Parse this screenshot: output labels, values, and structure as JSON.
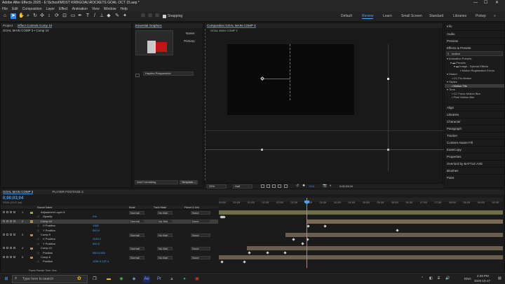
{
  "titlebar": {
    "title": "Adobe After Effects 2025 - E:\\School\\MOST KR8\\GOAL\\ROCKETS GOAL OCT 15.aep *",
    "min": "—",
    "max": "☐",
    "close": "✕"
  },
  "menu": [
    "File",
    "Edit",
    "Composition",
    "Layer",
    "Effect",
    "Animation",
    "View",
    "Window",
    "Help"
  ],
  "toolbar": {
    "snapping_label": "Snapping",
    "workspaces": [
      "Default",
      "Review",
      "Learn",
      "Small Screen",
      "Standard",
      "Libraries",
      "Pixtwp"
    ],
    "active_workspace": "Review"
  },
  "project_panel": {
    "tabs": [
      "Project",
      "Effect Controls Comp 10"
    ],
    "subtitle": "GOAL MAIN COMP 3 • Comp 10"
  },
  "essential_graphics": {
    "tab": "Essential Graphics",
    "name_label": "Name:",
    "primary_label": "Primary:",
    "dropdown": "Haydes Piaspaneldo",
    "add_formatting": "Add Formatting",
    "template_button": "Template..."
  },
  "composition": {
    "tab": "Composition GOAL MAIN COMP 3",
    "subtab": "GOAL MAIN COMP 3",
    "zoom": "25%",
    "resolution": "Half",
    "timecode": "0;00;03;04",
    "offset": "+0.0"
  },
  "right_panel": {
    "tabs_top": [
      "Info",
      "Audio",
      "Preview",
      "Effects & Presets"
    ],
    "search_value": "motion",
    "tree": [
      {
        "label": "Animation Presets",
        "level": 0
      },
      {
        "label": "Presets",
        "level": 1
      },
      {
        "label": "Image - Special Effects",
        "level": 2
      },
      {
        "label": "Motion Registration Errors",
        "level": 3
      },
      {
        "label": "Distort",
        "level": 0
      },
      {
        "label": "CC Flo Motion",
        "level": 1
      },
      {
        "label": "Stylize",
        "level": 0
      },
      {
        "label": "Motion Tile",
        "level": 1
      },
      {
        "label": "Time",
        "level": 0
      },
      {
        "label": "CC Force Motion Blur",
        "level": 1
      },
      {
        "label": "Pixel Motion Blur",
        "level": 1
      }
    ],
    "sections": [
      "Align",
      "Libraries",
      "Character",
      "Paragraph",
      "Tracker",
      "Content-Aware Fill",
      "EaseCopy",
      "Properties",
      "Overlord by BATTLE AXE",
      "Brushes",
      "Paint"
    ]
  },
  "timeline": {
    "tabs": [
      "GOAL MAIN COMP 3",
      "PLAYER FOOTAGE 3"
    ],
    "timecode": "0;00;03;04",
    "fps": "00094 (29.97 fps)",
    "headers": {
      "source": "Source Name",
      "mode": "Mode",
      "trkmat": "Track Matte",
      "parent": "Parent & Link"
    },
    "ruler": [
      "00:00f",
      "00:15f",
      "01:00f",
      "01:15f",
      "02:00f",
      "02:15f",
      "03:00f",
      "03:15f",
      "04:00f",
      "04:15f",
      "05:00f",
      "05:15f",
      "06:00f",
      "06:15f",
      "07:00f",
      "07:15f",
      "08:00f",
      "08:15f",
      "09:00f",
      "09:15f",
      "10:0"
    ],
    "rows": [
      {
        "num": "1",
        "name": "Adjustment Layer 8",
        "value": "",
        "mode": "Normal",
        "trk": "No Mat",
        "parent": "None",
        "color": "#a3a35a"
      },
      {
        "num": "",
        "name": "Opacity",
        "value": "0%",
        "mode": "",
        "trk": "",
        "parent": "",
        "color": ""
      },
      {
        "num": "2",
        "name": "Comp 10",
        "value": "",
        "mode": "Normal",
        "trk": "No Mat",
        "parent": "None",
        "color": "#b08a5a"
      },
      {
        "num": "",
        "name": "X Position",
        "value": "1362",
        "mode": "",
        "trk": "",
        "parent": "",
        "color": ""
      },
      {
        "num": "",
        "name": "Y Position",
        "value": "540.0",
        "mode": "",
        "trk": "",
        "parent": "",
        "color": ""
      },
      {
        "num": "3",
        "name": "Comp 9",
        "value": "",
        "mode": "Normal",
        "trk": "No Mat",
        "parent": "None",
        "color": "#b08a5a"
      },
      {
        "num": "",
        "name": "X Position",
        "value": "1149.1",
        "mode": "",
        "trk": "",
        "parent": "",
        "color": ""
      },
      {
        "num": "",
        "name": "Y Position",
        "value": "540.0",
        "mode": "",
        "trk": "",
        "parent": "",
        "color": ""
      },
      {
        "num": "4",
        "name": "Comp 12",
        "value": "",
        "mode": "Normal",
        "trk": "No Mat",
        "parent": "None",
        "color": "#b08a5a"
      },
      {
        "num": "",
        "name": "Position",
        "value": "960.0,540",
        "mode": "",
        "trk": "",
        "parent": "",
        "color": ""
      },
      {
        "num": "5",
        "name": "Comp 6",
        "value": "",
        "mode": "Normal",
        "trk": "No Mat",
        "parent": "None",
        "color": "#b08a5a"
      },
      {
        "num": "",
        "name": "Position",
        "value": "1261.0,137.4",
        "mode": "",
        "trk": "",
        "parent": "",
        "color": ""
      }
    ],
    "footer": "Frame Render Time: 0ms"
  },
  "taskbar": {
    "search_placeholder": "Type here to search",
    "lang": "ENG",
    "time": "2:29 PM",
    "date": "2025-10-17"
  },
  "colors": {
    "accent": "#2d8ceb",
    "selected_row": "#3d3d3d",
    "playhead": "#4aa3ff"
  }
}
